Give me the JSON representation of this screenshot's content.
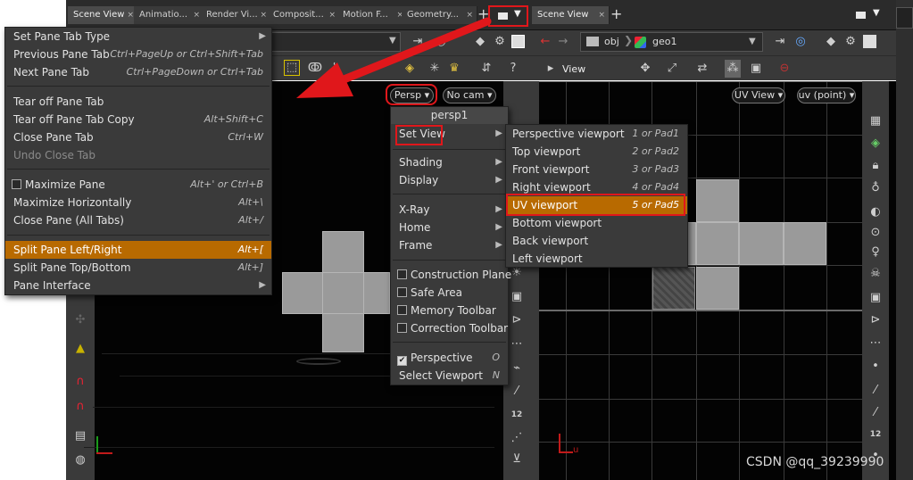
{
  "left_tabs": [
    {
      "label": "Scene View"
    },
    {
      "label": "Animatio..."
    },
    {
      "label": "Render Vi..."
    },
    {
      "label": "Composit..."
    },
    {
      "label": "Motion F..."
    },
    {
      "label": "Geometry..."
    }
  ],
  "right_tab": {
    "label": "Scene View"
  },
  "add_tab": "+",
  "right_nav": {
    "path1": "obj",
    "path2": "geo1"
  },
  "right_toolbar": {
    "view_label": "View"
  },
  "left_viewport": {
    "persp_btn": "Persp",
    "cam_btn": "No cam"
  },
  "right_viewport": {
    "uv_view_btn": "UV View",
    "uv_attr_btn": "uv (point)",
    "axis_label": "u"
  },
  "pane_menu": {
    "items": [
      {
        "label": "Set Pane Tab Type",
        "shortcut": "",
        "submenu": true
      },
      {
        "label": "Previous Pane Tab",
        "shortcut": "Ctrl+PageUp or Ctrl+Shift+Tab"
      },
      {
        "label": "Next Pane Tab",
        "shortcut": "Ctrl+PageDown or Ctrl+Tab"
      },
      {
        "label": "Tear off Pane Tab",
        "shortcut": ""
      },
      {
        "label": "Tear off Pane Tab Copy",
        "shortcut": "Alt+Shift+C"
      },
      {
        "label": "Close Pane Tab",
        "shortcut": "Ctrl+W"
      },
      {
        "label": "Undo Close Tab",
        "shortcut": "",
        "disabled": true
      },
      {
        "label": "Maximize Pane",
        "shortcut": "Alt+' or Ctrl+B",
        "checkbox": true
      },
      {
        "label": "Maximize Horizontally",
        "shortcut": "Alt+\\"
      },
      {
        "label": "Close Pane (All Tabs)",
        "shortcut": "Alt+/"
      },
      {
        "label": "Split Pane Left/Right",
        "shortcut": "Alt+[",
        "highlight": true
      },
      {
        "label": "Split Pane Top/Bottom",
        "shortcut": "Alt+]"
      },
      {
        "label": "Pane Interface",
        "shortcut": "",
        "submenu": true
      }
    ]
  },
  "view_menu": {
    "header": "persp1",
    "set_view": "Set View",
    "shading": "Shading",
    "display": "Display",
    "xray": "X-Ray",
    "home": "Home",
    "frame": "Frame",
    "construction_plane": "Construction Plane",
    "safe_area": "Safe Area",
    "memory_toolbar": "Memory Toolbar",
    "correction_toolbar": "Correction Toolbar",
    "perspective": "Perspective",
    "perspective_sc": "O",
    "select_viewport": "Select Viewport",
    "select_viewport_sc": "N"
  },
  "setview_menu": {
    "items": [
      {
        "label": "Perspective viewport",
        "shortcut": "1 or Pad1"
      },
      {
        "label": "Top viewport",
        "shortcut": "2 or Pad2"
      },
      {
        "label": "Front viewport",
        "shortcut": "3 or Pad3"
      },
      {
        "label": "Right viewport",
        "shortcut": "4 or Pad4"
      },
      {
        "label": "UV viewport",
        "shortcut": "5 or Pad5",
        "highlight": true
      },
      {
        "label": "Bottom viewport",
        "shortcut": ""
      },
      {
        "label": "Back viewport",
        "shortcut": ""
      },
      {
        "label": "Left viewport",
        "shortcut": ""
      }
    ]
  },
  "right_icons": {
    "n12": "12"
  },
  "left_icons": {
    "n12": "12"
  },
  "watermark": "CSDN @qq_39239990",
  "colors": {
    "highlight": "#b86a00",
    "annotation_red": "#e0171b"
  }
}
